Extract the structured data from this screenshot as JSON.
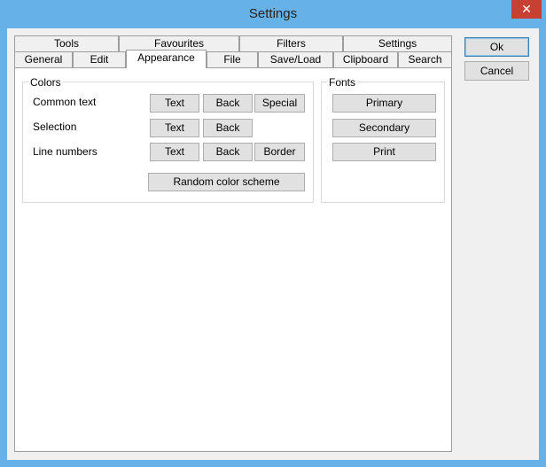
{
  "window": {
    "title": "Settings",
    "close_glyph": "✕"
  },
  "tabs": {
    "row_back": [
      "Tools",
      "Favourites",
      "Filters",
      "Settings"
    ],
    "row_front": [
      "General",
      "Edit",
      "Appearance",
      "File",
      "Save/Load",
      "Clipboard",
      "Search"
    ],
    "selected": "Appearance"
  },
  "colors_group": {
    "label": "Colors",
    "rows": [
      {
        "label": "Common text",
        "buttons": [
          "Text",
          "Back",
          "Special"
        ]
      },
      {
        "label": "Selection",
        "buttons": [
          "Text",
          "Back"
        ]
      },
      {
        "label": "Line numbers",
        "buttons": [
          "Text",
          "Back",
          "Border"
        ]
      }
    ],
    "random_button": "Random color scheme"
  },
  "fonts_group": {
    "label": "Fonts",
    "buttons": [
      "Primary",
      "Secondary",
      "Print"
    ]
  },
  "dialog_buttons": {
    "ok": "Ok",
    "cancel": "Cancel"
  },
  "icons": {
    "close": "close-icon"
  }
}
